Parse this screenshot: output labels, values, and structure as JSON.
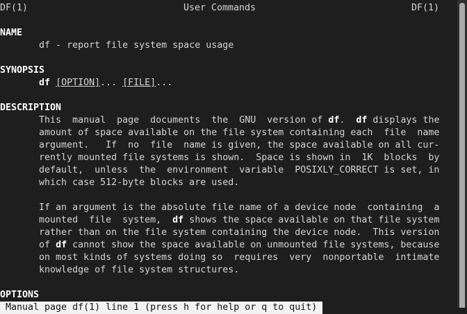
{
  "header": {
    "left": "DF(1)",
    "center": "User Commands",
    "right": "DF(1)"
  },
  "lines": [
    [],
    [
      {
        "t": "NAME",
        "b": true
      }
    ],
    [
      {
        "t": "       df - report file system space usage"
      }
    ],
    [],
    [
      {
        "t": "SYNOPSIS",
        "b": true
      }
    ],
    [
      {
        "t": "       "
      },
      {
        "t": "df",
        "b": true
      },
      {
        "t": " "
      },
      {
        "t": "[OPTION]",
        "u": true
      },
      {
        "t": "... "
      },
      {
        "t": "[FILE]",
        "u": true
      },
      {
        "t": "..."
      }
    ],
    [],
    [
      {
        "t": "DESCRIPTION",
        "b": true
      }
    ],
    [
      {
        "t": "       This  manual  page  documents  the  GNU  version of "
      },
      {
        "t": "df",
        "b": true
      },
      {
        "t": ".  "
      },
      {
        "t": "df",
        "b": true
      },
      {
        "t": " displays the"
      }
    ],
    [
      {
        "t": "       amount of space available on the file system containing each  file  name"
      }
    ],
    [
      {
        "t": "       argument.   If  no  file  name is given, the space available on all cur-"
      }
    ],
    [
      {
        "t": "       rently mounted file systems is shown.  Space is shown in  1K  blocks  by"
      }
    ],
    [
      {
        "t": "       default,  unless  the  environment  variable  POSIXLY_CORRECT is set, in"
      }
    ],
    [
      {
        "t": "       which case 512-byte blocks are used."
      }
    ],
    [],
    [
      {
        "t": "       If an argument is the absolute file name of a device node  containing  a"
      }
    ],
    [
      {
        "t": "       mounted  file  system,  "
      },
      {
        "t": "df",
        "b": true
      },
      {
        "t": " shows the space available on that file system"
      }
    ],
    [
      {
        "t": "       rather than on the file system containing the device node.  This version"
      }
    ],
    [
      {
        "t": "       of "
      },
      {
        "t": "df",
        "b": true
      },
      {
        "t": " cannot show the space available on unmounted file systems, because"
      }
    ],
    [
      {
        "t": "       on most kinds of systems doing so  requires  very  nonportable  intimate"
      }
    ],
    [
      {
        "t": "       knowledge of file system structures."
      }
    ],
    [],
    [
      {
        "t": "OPTIONS",
        "b": true
      }
    ]
  ],
  "status": "Manual page df(1) line 1 (press h for help or q to quit)"
}
